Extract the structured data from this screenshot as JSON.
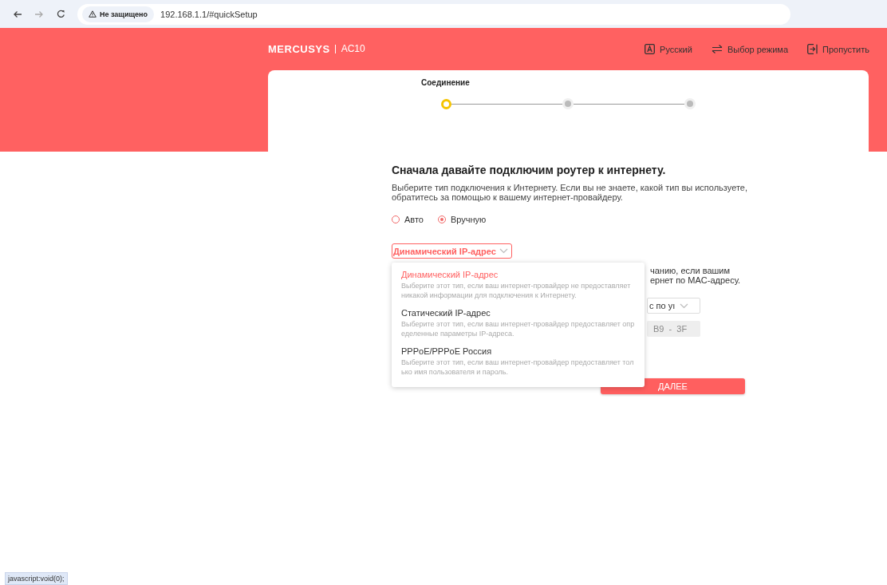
{
  "browser": {
    "security": "Не защищено",
    "url": "192.168.1.1/#quickSetup"
  },
  "header": {
    "logo": "MERCUSYS",
    "model": "AC10",
    "links": [
      {
        "kind": "language",
        "label": "Русский"
      },
      {
        "kind": "mode",
        "label": "Выбор режима"
      },
      {
        "kind": "skip",
        "label": "Пропустить"
      }
    ]
  },
  "stepper": {
    "label": "Соединение",
    "steps": [
      {
        "selected": true
      },
      {
        "selected": false
      },
      {
        "selected": false
      }
    ]
  },
  "heading": "Сначала давайте подключим роутер к интернету.",
  "description": "Выберите тип подключения к Интернету. Если вы не знаете, какой тип вы используете, обратитесь за помощью к вашему интернет-провайдеру.",
  "connection_mode": [
    {
      "label": "Авто",
      "selected": false
    },
    {
      "label": "Вручную",
      "selected": true
    }
  ],
  "connection_type": {
    "value": "Динамический IP-адрес",
    "expanded": true,
    "options": [
      {
        "label": "Динамический IP-адрес",
        "description": "Выберите этот тип, если ваш интернет-провайдер не предоставляет никакой информации для подключения к Интернету.",
        "selected": true
      },
      {
        "label": "Статический IP-адрес",
        "description": "Выберите этот тип, если ваш интернет-провайдер предоставляет определенные параметры IP-адреса.",
        "selected": false
      },
      {
        "label": "PPPoE/PPPoE Россия",
        "description": "Выберите этот тип, если ваш интернет-провайдер предоставляет только имя пользователя и пароль.",
        "selected": false
      }
    ]
  },
  "mac_section": {
    "note_lines": [
      "чанию, если вашим",
      "ернет по MAC-адресу."
    ],
    "mac_select": "с по уı",
    "mac_field": "B9  -  3F"
  },
  "next_button": "ДАЛЕЕ",
  "status_text": "javascript:void(0);"
}
